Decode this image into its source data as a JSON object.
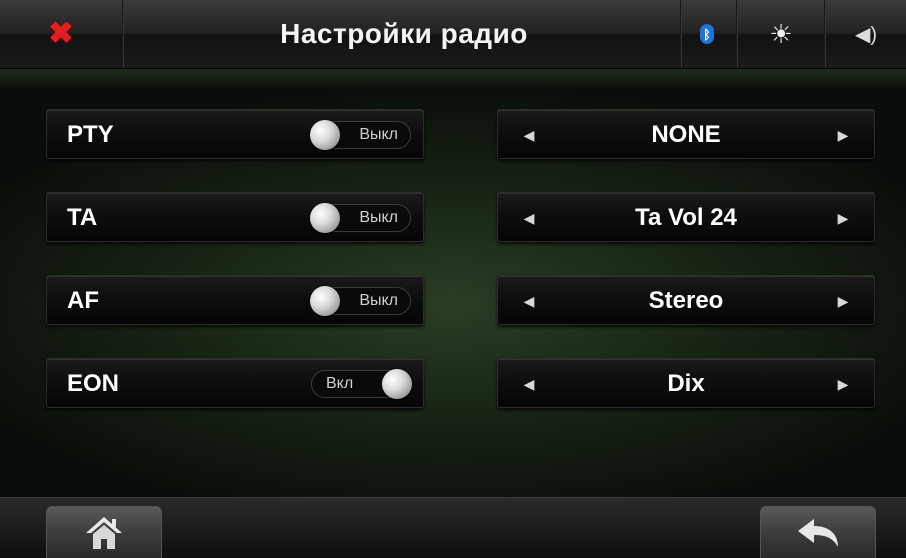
{
  "header": {
    "title": "Настройки радио",
    "close_icon": "close-icon",
    "bluetooth_icon": "bluetooth-icon",
    "brightness_icon": "brightness-icon",
    "volume_icon": "volume-icon",
    "close_color": "#e02020",
    "bluetooth_color": "#1e73d8"
  },
  "toggles": [
    {
      "label": "PTY",
      "state": "Выкл",
      "on": false
    },
    {
      "label": "TA",
      "state": "Выкл",
      "on": false
    },
    {
      "label": "AF",
      "state": "Выкл",
      "on": false
    },
    {
      "label": "EON",
      "state": "Вкл",
      "on": true
    }
  ],
  "selectors": [
    {
      "value": "NONE"
    },
    {
      "value": "Ta Vol 24"
    },
    {
      "value": "Stereo"
    },
    {
      "value": "Dix"
    }
  ],
  "footer": {
    "home_icon": "home-icon",
    "back_icon": "back-icon"
  }
}
